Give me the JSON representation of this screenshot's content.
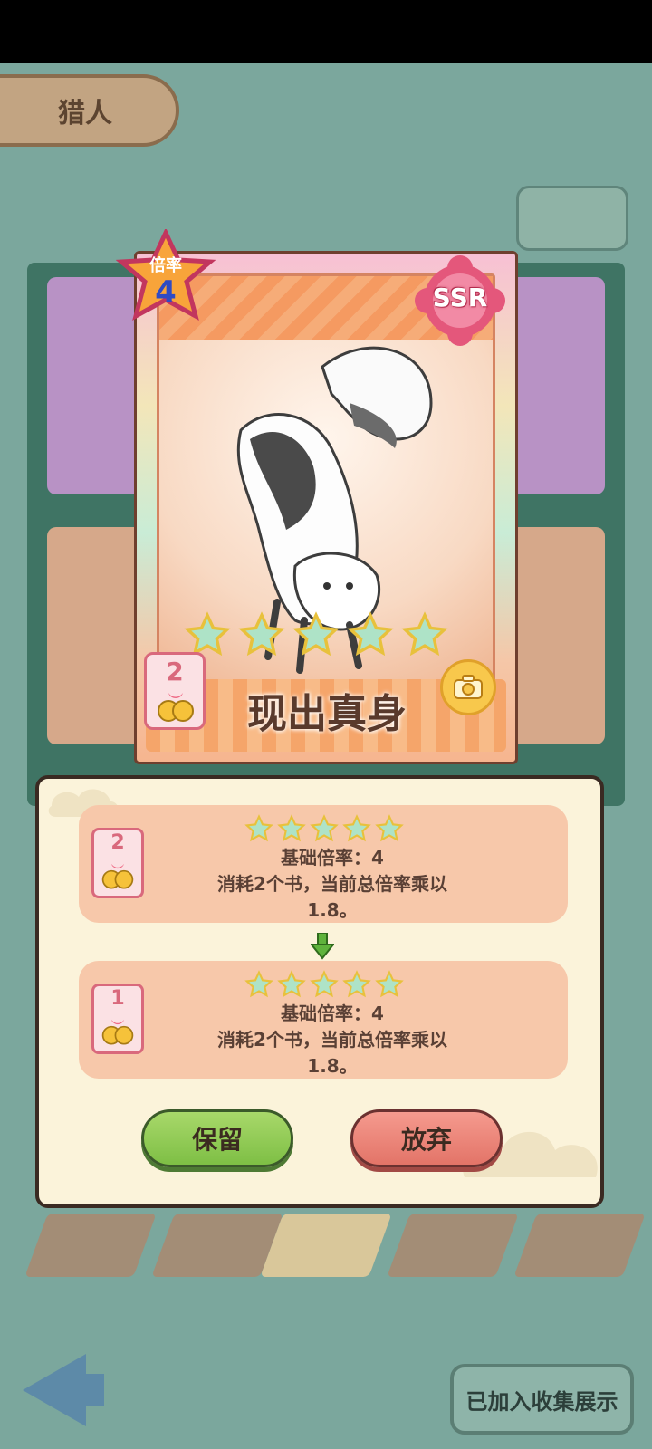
{
  "background": {
    "tab_label": "猎人",
    "bottom_button": "已加入收集展示"
  },
  "card": {
    "multiplier_label": "倍率",
    "multiplier_value": "4",
    "rarity": "SSR",
    "name": "现出真身",
    "cost": "2",
    "star_count": 5
  },
  "dialog": {
    "current": {
      "cost": "2",
      "star_count": 5,
      "line1": "基础倍率：4",
      "line2": "消耗2个书，当前总倍率乘以",
      "line3": "1.8。"
    },
    "next": {
      "cost": "1",
      "star_count": 5,
      "line1": "基础倍率：4",
      "line2": "消耗2个书，当前总倍率乘以",
      "line3": "1.8。"
    },
    "keep_label": "保留",
    "discard_label": "放弃"
  },
  "colors": {
    "accent_green": "#7ebf45",
    "accent_red": "#e37468",
    "dialog_bg": "#fbf3da",
    "info_box": "#f7c8aa"
  }
}
